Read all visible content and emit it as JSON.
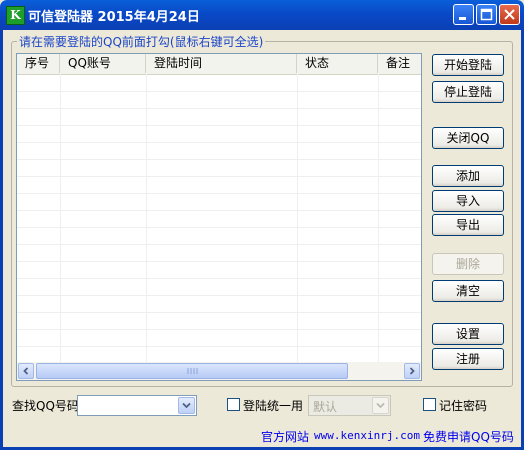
{
  "window": {
    "icon_letter": "K",
    "title": "可信登陆器  2015年4月24日"
  },
  "group_label": "请在需要登陆的QQ前面打勾(鼠标右键可全选)",
  "list": {
    "columns": [
      "序号",
      "QQ账号",
      "登陆时间",
      "状态",
      "备注"
    ],
    "rows": []
  },
  "buttons": {
    "start": "开始登陆",
    "stop": "停止登陆",
    "close_qq": "关闭QQ",
    "add": "添加",
    "import": "导入",
    "export": "导出",
    "delete": "删除",
    "clear": "清空",
    "settings": "设置",
    "register": "注册"
  },
  "bottom": {
    "search_label": "查找QQ号码",
    "search_value": "",
    "unify_login_label": "登陆统一用",
    "unify_login_checked": false,
    "unify_select_value": "默认",
    "remember_password_label": "记住密码",
    "remember_password_checked": false,
    "official_site_label": "官方网站",
    "official_site_url": "www.kenxinrj.com",
    "free_apply_link": "免费申请QQ号码"
  },
  "colors": {
    "titlebar": "#0a5fd8",
    "window_bg": "#ece9d8",
    "group_label": "#1c45c8",
    "link": "#0000ee"
  }
}
